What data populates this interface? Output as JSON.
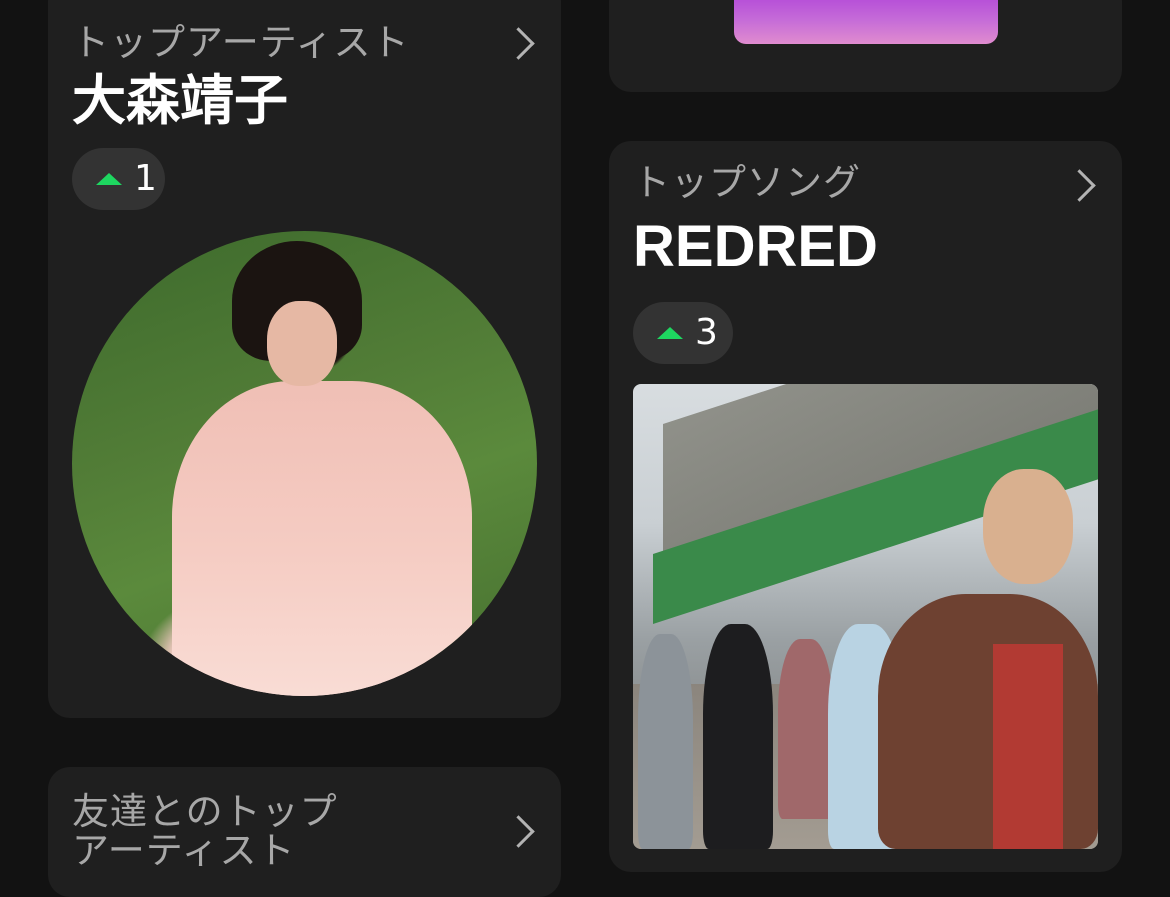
{
  "top_artist": {
    "label": "トップアーティスト",
    "name": "大森靖子",
    "rank": "1",
    "rank_change": "up"
  },
  "top_song": {
    "label": "トップソング",
    "title": "REDRED",
    "rank": "3",
    "rank_change": "up"
  },
  "friends_card": {
    "label_line1": "友達とのトップ",
    "label_line2": "アーティスト"
  },
  "colors": {
    "background": "#121212",
    "card": "#1f1f1f",
    "accent_green": "#1ed760",
    "pill": "#333333"
  },
  "icons": {
    "chevron": "chevron-right-icon",
    "rank_up": "triangle-up-icon"
  }
}
